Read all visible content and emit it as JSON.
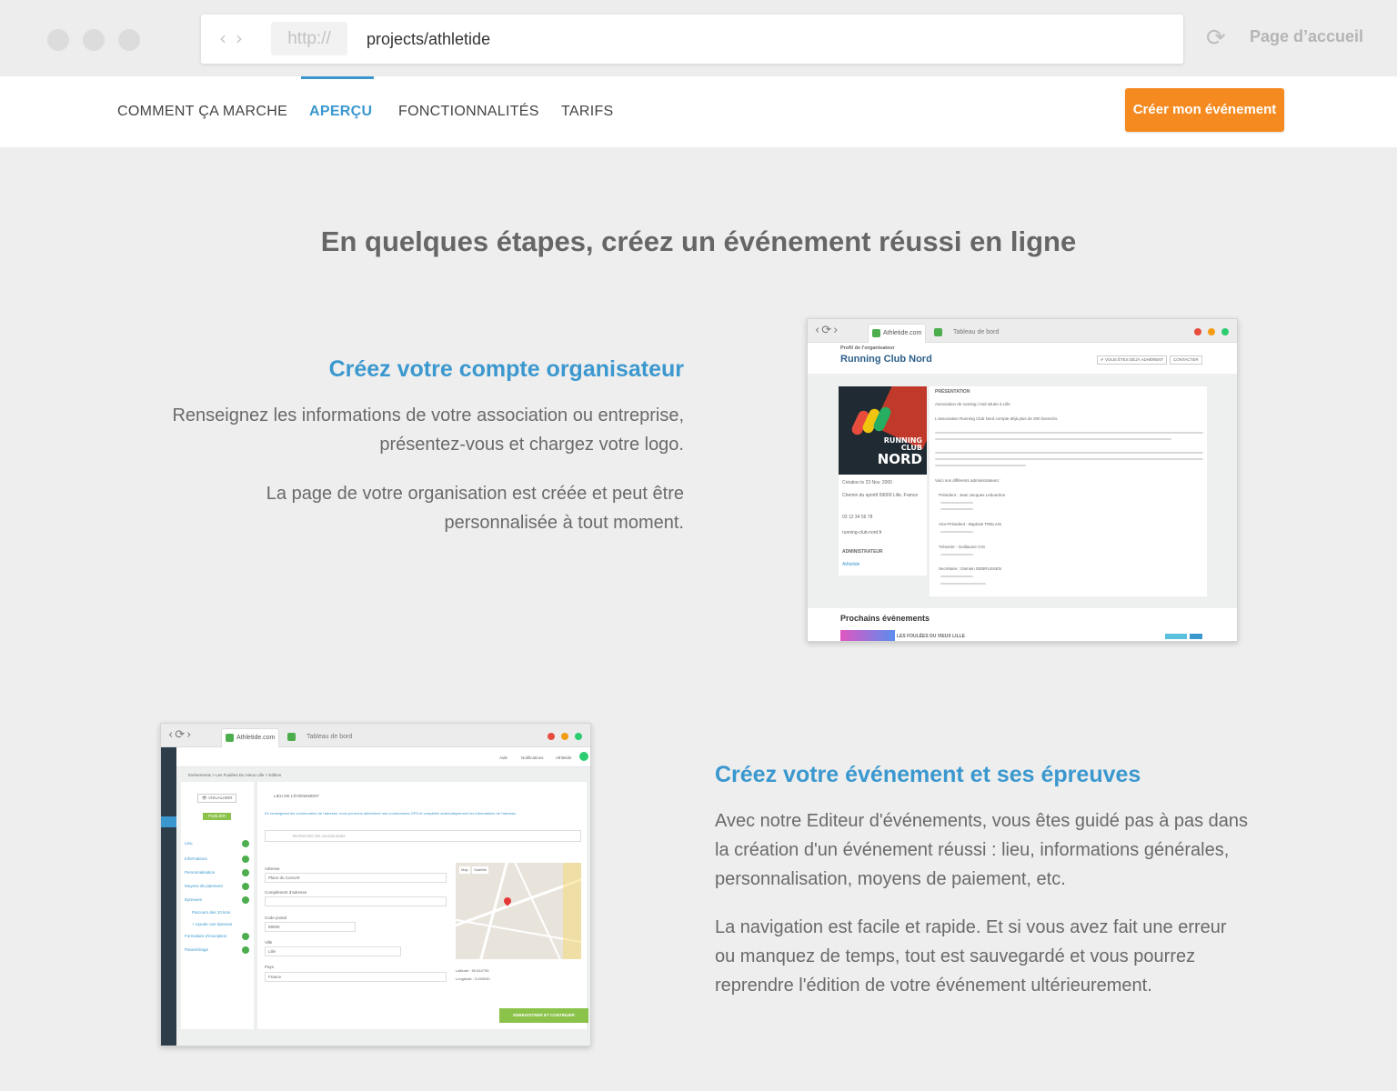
{
  "browser": {
    "protocol": "http://",
    "path": "projects/athletide",
    "home_link": "Page d’accueil",
    "reload_icon": "reload-icon"
  },
  "nav": {
    "items": [
      {
        "label": "COMMENT ÇA MARCHE"
      },
      {
        "label": "APERÇU",
        "active": true
      },
      {
        "label": "FONCTIONNALITÉS"
      },
      {
        "label": "TARIFS"
      }
    ],
    "cta": "Créer mon événement"
  },
  "colors": {
    "accent": "#3b98cf",
    "cta": "#f58a20",
    "success": "#4cae4c"
  },
  "headline": "En quelques étapes, créez un événement réussi en ligne",
  "section1": {
    "title": "Créez votre compte organisateur",
    "para1": "Renseignez les informations de votre association ou entreprise, présentez-vous et chargez votre logo.",
    "para2": "La page de votre organisation est créée et peut être personnalisée à tout moment.",
    "mock": {
      "tab1": "Athletide.com",
      "tab2": "Tableau de bord",
      "profile_label": "Profil de l'organisateur",
      "org_name": "Running Club Nord",
      "btn_member": "✔ VOUS ÊTES DÉJÀ ADHÉRENT",
      "btn_contact": "CONTACTER",
      "logo_line1": "RUNNING",
      "logo_line2": "CLUB",
      "logo_line3": "NORD",
      "creation": "Création le 23 Nov. 2000",
      "address": "Chemin du sportif 59000 Lille, France",
      "phone": "03 12 34 56 78",
      "website": "running-club-nord.fr",
      "admin_label": "ADMINISTRATEUR",
      "admin_name": "Athletide",
      "presentation_label": "PRÉSENTATION",
      "pres_line1": "Association de running / trail située à Lille",
      "pres_line2": "L'association Running Club Nord compte déjà plus de 200 licenciés.",
      "admins_intro": "Voici nos différents administrateurs :",
      "role1": "Président : Jean Jacques Lebourdon",
      "role2": "Vice-Président : Baptiste TRELAIS",
      "role3": "Trésorier : Guillaume CIG",
      "role4": "Secrétaire : Damien DEBRUSSEN",
      "upcoming": "Prochains évènements",
      "event_name": "LES FOULÉES DU VIEUX LILLE"
    }
  },
  "section2": {
    "title": "Créez votre événement et ses épreuves",
    "para1": "Avec notre Editeur d'événements, vous êtes guidé pas à pas dans la création d'un événement réussi : lieu, informations générales, personnalisation, moyens de paiement, etc.",
    "para2": "La navigation est facile et rapide. Et si vous avez fait une erreur ou manquez de temps, tout est sauvegardé et vous pourrez reprendre l'édition de votre événement ultérieurement.",
    "mock": {
      "tab1": "Athletide.com",
      "tab2": "Tableau de bord",
      "top_aide": "Aide",
      "top_notif": "Notifications",
      "top_user": "Athletide",
      "breadcrumb": "Evénements  >  Les Foulées Du Vieux Lille  >  Edition",
      "btn_visualiser": "👁 VISUALISER",
      "btn_publier": "PUBLIER",
      "steps": [
        "Lieu",
        "Informations",
        "Personnalisation",
        "Moyens de paiement",
        "Epreuves",
        "Parcours des 10 kms",
        "+ Ajouter une épreuve",
        "Formulaire d'inscription",
        "Paramétrage"
      ],
      "section_title": "LIEU DE L'ÉVÉNEMENT",
      "info_text": "En renseignant les coordonnées de l'adresse, nous pourrons déterminer ses coordonnées GPS et compléter automatiquement les informations de l'adresse.",
      "search_placeholder": "Rechercher les coordonnées",
      "f_adresse_label": "Adresse",
      "f_adresse": "Place du Concert",
      "f_complement_label": "Complément d'adresse",
      "f_cp_label": "Code postal",
      "f_cp": "59000",
      "f_ville_label": "Ville",
      "f_ville": "Lille",
      "f_pays_label": "Pays",
      "f_pays": "France",
      "map_tab1": "Map",
      "map_tab2": "Satellite",
      "latitude": "Latitude : 50.642759",
      "longitude": "Longitude : 3.065930",
      "btn_save": "ENREGISTRER ET CONTINUER"
    }
  }
}
